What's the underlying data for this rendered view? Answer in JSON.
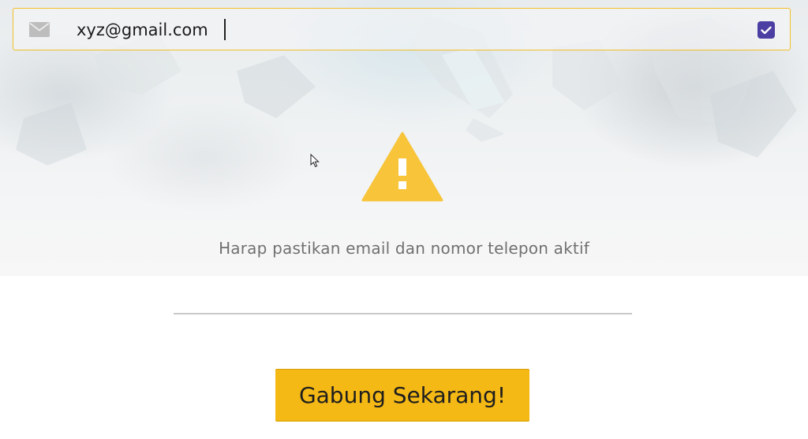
{
  "form": {
    "email_value": "xyz@gmail.com",
    "email_icon": "envelope-icon",
    "verified_icon": "checkbox-checked-icon"
  },
  "warning": {
    "icon": "warning-triangle-icon",
    "message": "Harap pastikan email dan nomor telepon aktif"
  },
  "actions": {
    "join_label": "Gabung Sekarang!"
  },
  "colors": {
    "accent_yellow": "#f5b915",
    "field_border": "#f2bf2a",
    "check_purple": "#4b3fa3",
    "warning_yellow": "#f7c43a",
    "message_gray": "#707070"
  }
}
